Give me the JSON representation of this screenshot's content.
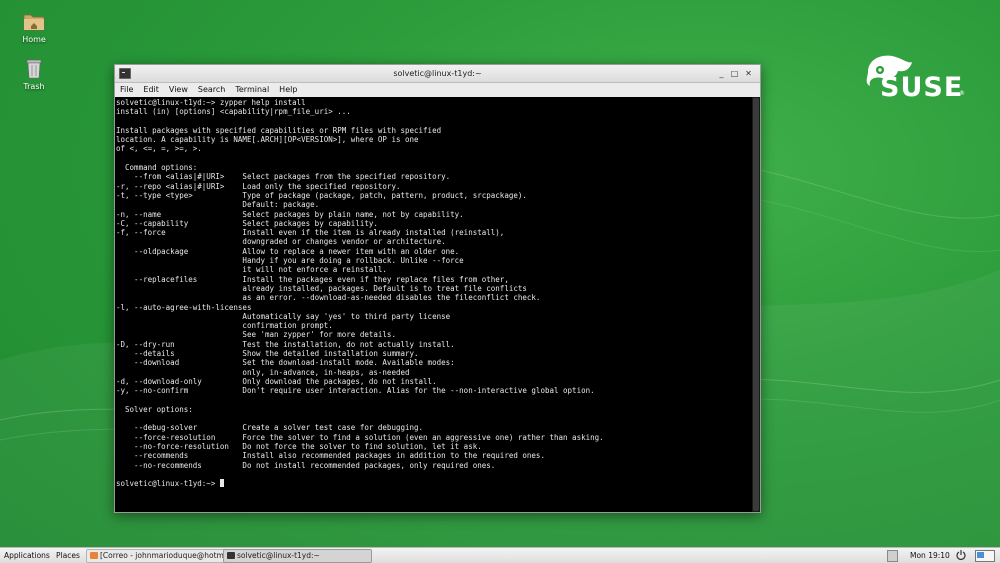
{
  "desktop": {
    "icons": [
      {
        "label": "Home"
      },
      {
        "label": "Trash"
      }
    ]
  },
  "logo": {
    "text": "SUSE",
    "reg": "®"
  },
  "window": {
    "title": "solvetic@linux-t1yd:~",
    "menu": [
      "File",
      "Edit",
      "View",
      "Search",
      "Terminal",
      "Help"
    ],
    "terminal_lines": [
      "solvetic@linux-t1yd:~> zypper help install",
      "install (in) [options] <capability|rpm_file_uri> ...",
      "",
      "Install packages with specified capabilities or RPM files with specified",
      "location. A capability is NAME[.ARCH][OP<VERSION>], where OP is one",
      "of <, <=, =, >=, >.",
      "",
      "  Command options:",
      "    --from <alias|#|URI>    Select packages from the specified repository.",
      "-r, --repo <alias|#|URI>    Load only the specified repository.",
      "-t, --type <type>           Type of package (package, patch, pattern, product, srcpackage).",
      "                            Default: package.",
      "-n, --name                  Select packages by plain name, not by capability.",
      "-C, --capability            Select packages by capability.",
      "-f, --force                 Install even if the item is already installed (reinstall),",
      "                            downgraded or changes vendor or architecture.",
      "    --oldpackage            Allow to replace a newer item with an older one.",
      "                            Handy if you are doing a rollback. Unlike --force",
      "                            it will not enforce a reinstall.",
      "    --replacefiles          Install the packages even if they replace files from other,",
      "                            already installed, packages. Default is to treat file conflicts",
      "                            as an error. --download-as-needed disables the fileconflict check.",
      "-l, --auto-agree-with-licenses",
      "                            Automatically say 'yes' to third party license",
      "                            confirmation prompt.",
      "                            See 'man zypper' for more details.",
      "-D, --dry-run               Test the installation, do not actually install.",
      "    --details               Show the detailed installation summary.",
      "    --download              Set the download-install mode. Available modes:",
      "                            only, in-advance, in-heaps, as-needed",
      "-d, --download-only         Only download the packages, do not install.",
      "-y, --no-confirm            Don't require user interaction. Alias for the --non-interactive global option.",
      "",
      "  Solver options:",
      "",
      "    --debug-solver          Create a solver test case for debugging.",
      "    --force-resolution      Force the solver to find a solution (even an aggressive one) rather than asking.",
      "    --no-force-resolution   Do not force the solver to find solution, let it ask.",
      "    --recommends            Install also recommended packages in addition to the required ones.",
      "    --no-recommends         Do not install recommended packages, only required ones.",
      "",
      "solvetic@linux-t1yd:~> "
    ]
  },
  "panel": {
    "applications": "Applications",
    "places": "Places",
    "tasks": [
      {
        "label": "[Correo - johnmarioduque@hotmail...",
        "active": false,
        "icon_color": "#e8833a"
      },
      {
        "label": "solvetic@linux-t1yd:~",
        "active": true,
        "icon_color": "#333333"
      }
    ],
    "clock": "Mon 19:10"
  }
}
